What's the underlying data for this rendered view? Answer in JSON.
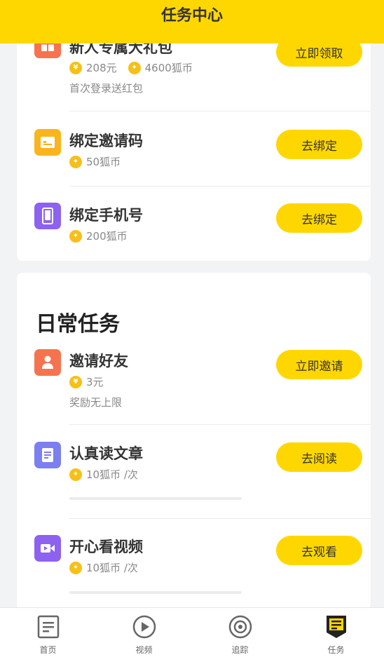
{
  "header": {
    "title": "任务中心"
  },
  "new_user_tasks": [
    {
      "name": "新人专属大礼包",
      "rewards": [
        {
          "type": "yuan",
          "symbol": "¥",
          "text": "208元"
        },
        {
          "type": "coin",
          "text": "4600狐币"
        }
      ],
      "desc": "首次登录送红包",
      "button": "立即领取",
      "icon": "gift-icon",
      "icon_color": "#f5734f"
    },
    {
      "name": "绑定邀请码",
      "rewards": [
        {
          "type": "coin",
          "text": "50狐币"
        }
      ],
      "button": "去绑定",
      "icon": "invite-code-icon",
      "icon_color": "#f9b51d"
    },
    {
      "name": "绑定手机号",
      "rewards": [
        {
          "type": "coin",
          "text": "200狐币"
        }
      ],
      "button": "去绑定",
      "icon": "phone-icon",
      "icon_color": "#8d62f0"
    }
  ],
  "daily": {
    "title": "日常任务",
    "tasks": [
      {
        "name": "邀请好友",
        "rewards": [
          {
            "type": "yuan",
            "symbol": "¥",
            "text": "3元"
          }
        ],
        "desc": "奖励无上限",
        "button": "立即邀请",
        "icon": "user-icon",
        "icon_color": "#f5734f"
      },
      {
        "name": "认真读文章",
        "rewards": [
          {
            "type": "coin",
            "text": "10狐币 /次"
          }
        ],
        "button": "去阅读",
        "icon": "article-icon",
        "icon_color": "#7b7ff0"
      },
      {
        "name": "开心看视频",
        "rewards": [
          {
            "type": "coin",
            "text": "10狐币 /次"
          }
        ],
        "button": "去观看",
        "icon": "video-icon",
        "icon_color": "#8d62f0"
      }
    ]
  },
  "tabbar": {
    "tabs": [
      {
        "label": "首页",
        "icon": "home-icon"
      },
      {
        "label": "视频",
        "icon": "play-icon"
      },
      {
        "label": "追踪",
        "icon": "target-icon"
      },
      {
        "label": "任务",
        "icon": "task-icon",
        "active": true
      }
    ]
  },
  "colors": {
    "accent": "#ffd700",
    "background": "#f2f3f5",
    "coin": "#f6c018"
  }
}
